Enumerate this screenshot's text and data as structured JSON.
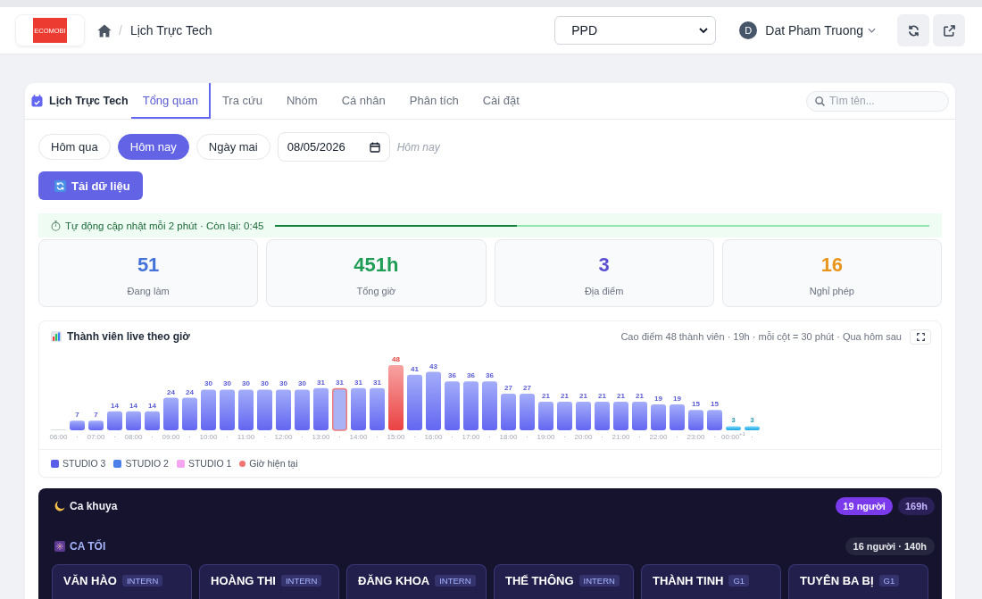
{
  "header": {
    "logo_text": "ECOMOBI",
    "breadcrumb_separator": "/",
    "page_title": "Lịch Trực Tech",
    "project_select": {
      "value": "PPD"
    },
    "user": {
      "initial": "D",
      "name": "Dat Pham Truong"
    }
  },
  "panel": {
    "title": "Lịch Trực Tech",
    "tabs": [
      {
        "label": "Tổng quan",
        "selected": true
      },
      {
        "label": "Tra cứu",
        "selected": false
      },
      {
        "label": "Nhóm",
        "selected": false
      },
      {
        "label": "Cá nhân",
        "selected": false
      },
      {
        "label": "Phân tích",
        "selected": false
      },
      {
        "label": "Cài đặt",
        "selected": false
      }
    ],
    "search": {
      "placeholder": "Tìm tên..."
    }
  },
  "date_bar": {
    "options": [
      {
        "label": "Hôm qua",
        "selected": false
      },
      {
        "label": "Hôm nay",
        "selected": true
      },
      {
        "label": "Ngày mai",
        "selected": false
      }
    ],
    "date_field": {
      "value": "08/05/2026"
    },
    "date_caption": "Hôm nay"
  },
  "load_button": {
    "label": "Tải dữ liệu"
  },
  "auto_update": {
    "text": "Tự động cập nhật mỗi 2 phút · Còn lại: 0:45",
    "level": 0.37
  },
  "stats": [
    {
      "value": "51",
      "label": "Đang làm",
      "color": "#4472d8"
    },
    {
      "value": "451h",
      "label": "Tổng giờ",
      "color": "#1f9d55"
    },
    {
      "value": "3",
      "label": "Địa điểm",
      "color": "#5a4fd1"
    },
    {
      "value": "16",
      "label": "Nghỉ phép",
      "color": "#e8961b"
    }
  ],
  "live_chart": {
    "title": "Thành viên live theo giờ",
    "summary": "Cao điểm 48 thành viên · 19h · mỗi cột = 30 phút · Qua hôm sau",
    "bars": [
      {
        "kind": "normal"
      },
      {
        "kind": "normal"
      },
      {
        "kind": "normal"
      },
      {
        "kind": "normal"
      },
      {
        "kind": "normal"
      },
      {
        "kind": "normal"
      },
      {
        "kind": "normal"
      },
      {
        "kind": "normal"
      },
      {
        "kind": "normal"
      },
      {
        "kind": "normal"
      },
      {
        "kind": "normal"
      },
      {
        "kind": "normal"
      },
      {
        "kind": "normal"
      },
      {
        "kind": "normal"
      },
      {
        "kind": "normal"
      },
      {
        "kind": "current"
      },
      {
        "kind": "normal"
      },
      {
        "kind": "normal"
      },
      {
        "kind": "peak"
      },
      {
        "kind": "normal"
      },
      {
        "kind": "normal"
      },
      {
        "kind": "normal"
      },
      {
        "kind": "normal"
      },
      {
        "kind": "normal"
      },
      {
        "kind": "normal"
      },
      {
        "kind": "normal"
      },
      {
        "kind": "normal"
      },
      {
        "kind": "normal"
      },
      {
        "kind": "normal"
      },
      {
        "kind": "normal"
      },
      {
        "kind": "normal"
      },
      {
        "kind": "normal"
      },
      {
        "kind": "normal"
      },
      {
        "kind": "normal"
      },
      {
        "kind": "normal"
      },
      {
        "kind": "normal"
      },
      {
        "kind": "next_day"
      },
      {
        "kind": "next_day"
      }
    ],
    "chart_data": {
      "type": "bar",
      "categories": [
        "06:00",
        "·",
        "07:00",
        "·",
        "08:00",
        "·",
        "09:00",
        "·",
        "10:00",
        "·",
        "11:00",
        "·",
        "12:00",
        "·",
        "13:00",
        "·",
        "14:00",
        "·",
        "15:00",
        "·",
        "16:00",
        "·",
        "17:00",
        "·",
        "18:00",
        "·",
        "19:00",
        "·",
        "20:00",
        "·",
        "21:00",
        "·",
        "22:00",
        "·",
        "23:00",
        "·",
        "00:00$^{+1}$",
        "·"
      ],
      "values": [
        0,
        7,
        7,
        14,
        14,
        14,
        24,
        24,
        30,
        30,
        30,
        30,
        30,
        30,
        31,
        31,
        31,
        31,
        48,
        41,
        43,
        36,
        36,
        36,
        27,
        27,
        21,
        21,
        21,
        21,
        21,
        21,
        19,
        19,
        15,
        15,
        3,
        3
      ],
      "value_labels": [
        null,
        "7",
        "7",
        "14",
        "14",
        "14",
        "24",
        "24",
        "30",
        "30",
        "30",
        "30",
        "30",
        "30",
        "31",
        "31",
        "31",
        "31",
        "48",
        "41",
        "43",
        "36",
        "36",
        "36",
        "27",
        "27",
        "21",
        "21",
        "21",
        "21",
        "21",
        "21",
        "19",
        "19",
        "15",
        "15",
        "3",
        "3"
      ]
    },
    "legend": [
      {
        "label": "STUDIO 3",
        "color": "#5b5ee8",
        "kind": "square"
      },
      {
        "label": "STUDIO 2",
        "color": "#4a80e8",
        "kind": "square"
      },
      {
        "label": "STUDIO 1",
        "color": "#f4a6f0",
        "kind": "square"
      },
      {
        "label": "Giờ hiện tại",
        "color": "#f07575",
        "kind": "dot"
      }
    ]
  },
  "night_shift": {
    "title": "Ca khuya",
    "people_badge": "19 người",
    "hours_badge": "169h",
    "groups": [
      {
        "title": "CA TỐI",
        "summary": "16 người · 140h",
        "members": [
          {
            "name": "VĂN HÀO",
            "tag": "INTERN"
          },
          {
            "name": "HOÀNG THI",
            "tag": "INTERN"
          },
          {
            "name": "ĐĂNG KHOA",
            "tag": "INTERN"
          },
          {
            "name": "THẾ THÔNG",
            "tag": "INTERN"
          },
          {
            "name": "THÀNH TINH",
            "tag": "G1"
          },
          {
            "name": "TUYÊN BA BỊ",
            "tag": "G1"
          }
        ]
      }
    ]
  }
}
